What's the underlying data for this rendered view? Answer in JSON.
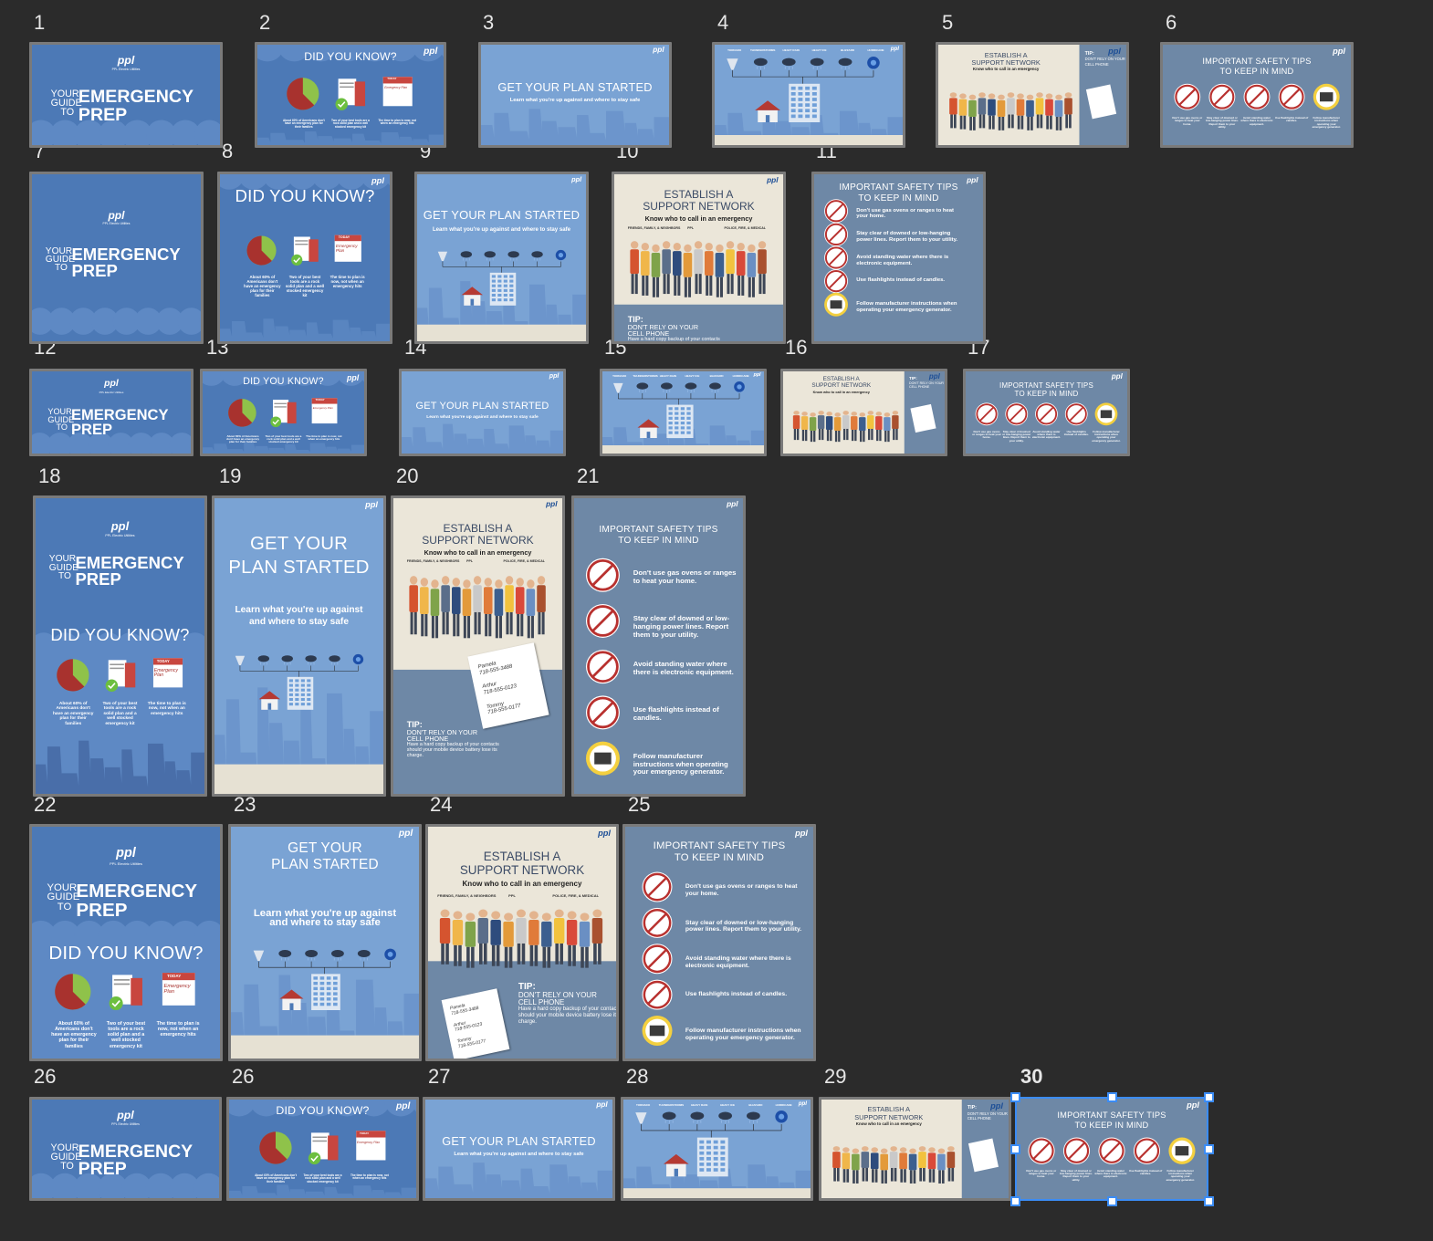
{
  "frame_numbers": [
    "1",
    "2",
    "3",
    "4",
    "5",
    "6",
    "7",
    "8",
    "9",
    "10",
    "11",
    "12",
    "13",
    "14",
    "15",
    "16",
    "17",
    "18",
    "19",
    "20",
    "21",
    "22",
    "23",
    "24",
    "25",
    "26",
    "26",
    "27",
    "28",
    "29",
    "30"
  ],
  "brand": {
    "logo": "ppl",
    "company": "PPL Electric Utilities"
  },
  "cover": {
    "your": "YOUR",
    "guide": "GUIDE",
    "to": "TO",
    "emergency": "EMERGENCY",
    "prep": "PREP"
  },
  "did_you_know": {
    "title": "DID YOU KNOW?",
    "fact1": "About 60% of Americans don't have an emergency plan for their families",
    "fact2": "Two of your best tools are a rock solid plan and a well stocked emergency kit",
    "fact3": "The time to plan is now, not when an emergency hits",
    "calendar_top": "TODAY",
    "calendar_text": "Emergency Plan"
  },
  "plan": {
    "title": "GET YOUR PLAN STARTED",
    "title_line1": "GET YOUR",
    "title_line2": "PLAN STARTED",
    "subtitle": "Learn what you're up against and where to stay safe",
    "subtitle_line1": "Learn what you're up against",
    "subtitle_line2": "and where to stay safe",
    "hazards": [
      "TORNADO",
      "THUNDERSTORMS",
      "HEAVY RAIN",
      "HEAVY ICE",
      "BLIZZARD",
      "HURRICANE"
    ]
  },
  "support": {
    "title_line1": "ESTABLISH A",
    "title_line2": "SUPPORT NETWORK",
    "subtitle": "Know who to call in an emergency",
    "group1": "FRIENDS, FAMILY, & NEIGHBORS",
    "group2": "PPL",
    "group3": "POLICE, FIRE, & MEDICAL",
    "tip_label": "TIP:",
    "tip_line1": "DON'T RELY ON YOUR",
    "tip_line2": "CELL PHONE",
    "tip_text": "Have a hard copy backup of your contacts should your mobile device battery lose its charge.",
    "contacts": [
      {
        "name": "Pamela",
        "phone": "718-555-3488"
      },
      {
        "name": "Arthur",
        "phone": "718-555-0123"
      },
      {
        "name": "Tommy",
        "phone": "718-555-0177"
      }
    ]
  },
  "safety": {
    "title_line1": "IMPORTANT SAFETY TIPS",
    "title_line2": "TO KEEP IN MIND",
    "tips": [
      "Don't use gas ovens or ranges to heat your home.",
      "Stay clear of downed or low-hanging power lines. Report them to your utility.",
      "Avoid standing water where there is electronic equipment.",
      "Use flashlights instead of candles.",
      "Follow manufacturer instructions when operating your emergency generator."
    ]
  },
  "colors": {
    "canvas_bg": "#2b2b2b",
    "slide_blue": "#4c79b6",
    "sky_blue": "#7aa3d4",
    "slate": "#6e88a6",
    "cream": "#e9e4d6",
    "selection": "#3b8cf5"
  },
  "selected_frame": "30"
}
